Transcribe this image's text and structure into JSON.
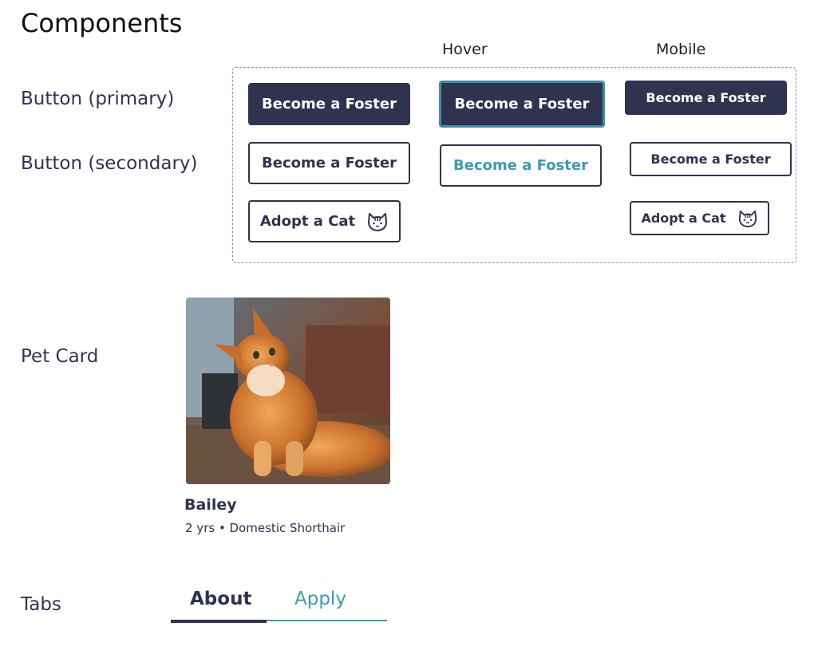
{
  "title": "Components",
  "columns": {
    "hover": "Hover",
    "mobile": "Mobile"
  },
  "rows": {
    "primary": "Button (primary)",
    "secondary": "Button (secondary)",
    "pet_card": "Pet Card",
    "tabs": "Tabs"
  },
  "buttons": {
    "foster": "Become a Foster",
    "adopt": "Adopt a Cat",
    "adopt_icon": "cat-face-icon"
  },
  "pet": {
    "name": "Bailey",
    "meta": "2 yrs • Domestic Shorthair",
    "image": "orange-cat-photo"
  },
  "tabs": [
    "About",
    "Apply"
  ],
  "colors": {
    "primary": "#2f3350",
    "accent": "#3d9ab0",
    "frame": "#a87ae0"
  }
}
